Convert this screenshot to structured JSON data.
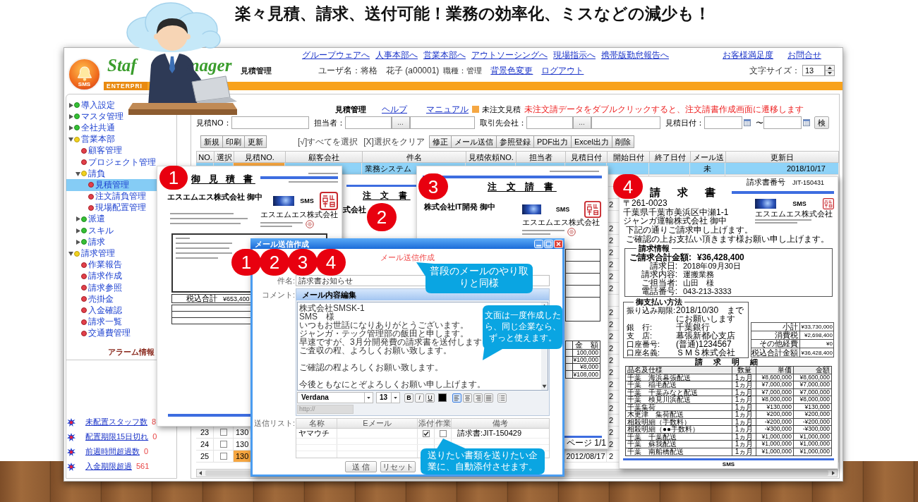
{
  "headline": "楽々見積、請求、送付可能！業務の効率化、ミスなどの減少も！",
  "header": {
    "emblem_text": "SMS",
    "brand_left": "Staf",
    "brand_right": "nager",
    "tagline": "ENTERPRI",
    "nav_links": [
      "グループウェアへ",
      "人事本部へ",
      "営業本部へ",
      "アウトソーシングへ",
      "現場指示へ",
      "携帯版勤怠報告へ"
    ],
    "support_links": [
      "お客様満足度",
      "お問合せ"
    ],
    "page_title": "見積管理",
    "user": "ユーザ名：将格　花子 (a00001)",
    "role": "職種：管理",
    "user_links": [
      "背景色変更",
      "ログアウト"
    ],
    "font_size_label": "文字サイズ：",
    "font_size": "13"
  },
  "sidebar": {
    "tree": [
      {
        "label": "導入設定",
        "kind": "group",
        "expanded": false,
        "selected": false
      },
      {
        "label": "マスタ管理",
        "kind": "group",
        "expanded": false,
        "selected": false
      },
      {
        "label": "全社共通",
        "kind": "group",
        "expanded": false,
        "selected": false
      },
      {
        "label": "営業本部",
        "kind": "group",
        "expanded": true,
        "selected": false,
        "children": [
          {
            "label": "顧客管理",
            "kind": "page",
            "selected": false
          },
          {
            "label": "プロジェクト管理",
            "kind": "page",
            "selected": false
          },
          {
            "label": "請負",
            "kind": "group",
            "expanded": true,
            "selected": false,
            "children": [
              {
                "label": "見積管理",
                "kind": "page",
                "selected": true
              },
              {
                "label": "注文請負管理",
                "kind": "page",
                "selected": false
              },
              {
                "label": "現場配置管理",
                "kind": "page",
                "selected": false
              }
            ]
          },
          {
            "label": "派遣",
            "kind": "group",
            "expanded": false,
            "selected": false
          },
          {
            "label": "スキル",
            "kind": "group",
            "expanded": false,
            "selected": false
          },
          {
            "label": "請求",
            "kind": "group",
            "expanded": false,
            "selected": false
          }
        ]
      },
      {
        "label": "請求管理",
        "kind": "group",
        "expanded": true,
        "selected": false,
        "children": [
          {
            "label": "作業報告",
            "kind": "page",
            "selected": false
          },
          {
            "label": "請求作成",
            "kind": "page",
            "selected": false
          },
          {
            "label": "請求参照",
            "kind": "page",
            "selected": false
          },
          {
            "label": "売掛金",
            "kind": "page",
            "selected": false
          },
          {
            "label": "入金確認",
            "kind": "page",
            "selected": false
          },
          {
            "label": "請求一覧",
            "kind": "page",
            "selected": false
          },
          {
            "label": "交通費管理",
            "kind": "page",
            "selected": false
          }
        ]
      }
    ],
    "alarm_title": "アラーム情報",
    "alarms": [
      {
        "label": "未配置スタッフ数",
        "count": "8"
      },
      {
        "label": "配置期限15日切れ",
        "count": "0"
      },
      {
        "label": "前週時間超過数",
        "count": "0"
      },
      {
        "label": "入金期限超過",
        "count": "561"
      }
    ]
  },
  "main": {
    "title": "見積管理",
    "links": [
      "ヘルプ",
      "マニュアル"
    ],
    "legend": "未注文見積",
    "notice": "未注文請データをダブルクリックすると、注文請書作成画面に遷移します",
    "search": [
      {
        "kind": "label",
        "text": "見積NO："
      },
      {
        "kind": "field"
      },
      {
        "kind": "label",
        "text": "担当者："
      },
      {
        "kind": "field"
      },
      {
        "kind": "picker",
        "text": "..."
      },
      {
        "kind": "field"
      },
      {
        "kind": "label",
        "text": "取引先会社："
      },
      {
        "kind": "field"
      },
      {
        "kind": "picker",
        "text": "..."
      },
      {
        "kind": "field"
      },
      {
        "kind": "label",
        "text": "見積日付："
      },
      {
        "kind": "field"
      },
      {
        "kind": "calendar"
      },
      {
        "kind": "label",
        "text": "〜"
      },
      {
        "kind": "field"
      },
      {
        "kind": "calendar"
      },
      {
        "kind": "button",
        "text": "検"
      }
    ],
    "toolbar": [
      {
        "kind": "buttons",
        "buttons": [
          "新規",
          "印刷",
          "更新"
        ]
      },
      {
        "kind": "link",
        "text": "[√]すべてを選択"
      },
      {
        "kind": "link",
        "text": "[X]選択をクリア"
      },
      {
        "kind": "buttons",
        "buttons": [
          "修正",
          "メール送信",
          "参照登録",
          "PDF出力",
          "Excel出力",
          "削除"
        ]
      }
    ],
    "columns": [
      "NO.",
      "選択",
      "見積NO.",
      "顧客会社",
      "件名",
      "見積依頼NO.",
      "担当者",
      "見積日付",
      "開始日付",
      "終了日付",
      "メール送",
      "更新日"
    ],
    "rows": [
      {
        "selected": true,
        "unordered": true,
        "subject": "業務システム",
        "mail_sent": "未",
        "updated": "2018/10/17"
      },
      {},
      {},
      {
        "start_date": "2"
      },
      {},
      {
        "start_date": "2"
      },
      {
        "start_date": "2"
      },
      {
        "start_date": "2"
      },
      {
        "start_date": "2"
      },
      {
        "start_date": "2"
      },
      {
        "start_date": "2"
      },
      {},
      {
        "start_date": "2"
      },
      {
        "start_date": "2"
      },
      {
        "start_date": "2"
      },
      {
        "start_date": "2"
      },
      {
        "start_date": "2"
      },
      {
        "start_date": "2"
      },
      {
        "start_date": "2"
      },
      {
        "start_date": "2"
      },
      {
        "start_date": "2"
      },
      {
        "start_date": "2"
      },
      {
        "selected": false,
        "no": "23",
        "checked": false,
        "unordered": false,
        "estimate_no": "130",
        "start_date": "2"
      },
      {
        "selected": false,
        "no": "24",
        "checked": false,
        "unordered": false,
        "estimate_no": "130",
        "start_date": "2"
      },
      {
        "selected": false,
        "no": "25",
        "checked": false,
        "unordered": true,
        "estimate_no": "130",
        "estimate_date": "2012/08/17",
        "start_date": "2"
      }
    ]
  },
  "documents": [
    {
      "kind": "estimate",
      "badge": "1",
      "title": "御 見 積 書",
      "addressee": "エスエムエス株式会社 御中",
      "logo_text": "SMS",
      "issuer": "エスエムエス株式会社",
      "total_label": "税込合計",
      "total": "¥653,400"
    },
    {
      "kind": "order",
      "badge": "2",
      "title": "注 文 書",
      "addressee": "式会社"
    },
    {
      "kind": "order_confirmation",
      "badge": "3",
      "title": "注 文 請 書",
      "addressee": "株式会社IT開発 御中",
      "logo_text": "SMS",
      "issuer": "エスエムエス株式会社",
      "amount_header": "金　額",
      "amounts": [
        "100,000",
        "¥100,000",
        "¥8,000",
        "¥108,000"
      ],
      "page": "ページ 1/1"
    },
    {
      "kind": "invoice",
      "badge": "4",
      "number_label": "請求書番号",
      "number": "JIT-150431",
      "title": "請 求 書",
      "recipient_lines": [
        "〒261-0023",
        "千葉県千葉市美浜区中瀬1-1",
        "ジャンガ運輸株式会社 御中"
      ],
      "logo_text": "SMS",
      "issuer": "エスエムエス株式会社",
      "message_lines": [
        "下記の通りご請求申し上げます。",
        "ご確認の上お支払い頂きます様お願い申し上げます。"
      ],
      "info_title": "請求情報",
      "total_label": "ご請求合計金額:",
      "total": "¥36,428,400",
      "info_rows": [
        {
          "label": "請求日:",
          "value": "2018年09月30日"
        },
        {
          "label": "請求内容:",
          "value": "運搬業務"
        },
        {
          "label": "ご担当者:",
          "value": "山田　様"
        },
        {
          "label": "電話番号:",
          "value": "043-213-3333"
        }
      ],
      "payment_title": "御支払い方法",
      "payment_rows": [
        {
          "label": "振り込み期限:",
          "value": "2018/10/30　までにお願いします"
        },
        {
          "label": "銀　行:",
          "value": "千葉銀行"
        },
        {
          "label": "支　店:",
          "value": "幕張新都心支店"
        },
        {
          "label": "口座番号:",
          "value": "(普通)1234567"
        },
        {
          "label": "口座名義:",
          "value": "ＳＭＳ株式会社"
        }
      ],
      "summary_rows": [
        {
          "label": "小計",
          "value": "¥33,730,000"
        },
        {
          "label": "消費税",
          "value": "¥2,698,400"
        },
        {
          "label": "その他経費",
          "value": "¥0"
        },
        {
          "label": "税込合計金額",
          "value": "¥36,428,400"
        }
      ],
      "detail_title": "請 求 明 細",
      "detail_columns": [
        "品名及仕様",
        "数量",
        "単価",
        "金額"
      ],
      "detail_rows": [
        [
          "千葉　海浜幕張配送",
          "1ヵ月",
          "¥8,600,000",
          "¥8,600,000"
        ],
        [
          "千葉　稲毛配送",
          "1ヵ月",
          "¥7,000,000",
          "¥7,000,000"
        ],
        [
          "千葉　千葉みなと配送",
          "1ヵ月",
          "¥7,000,000",
          "¥7,000,000"
        ],
        [
          "千葉　検見川浜配送",
          "1ヵ月",
          "¥8,000,000",
          "¥8,000,000"
        ],
        [
          "千葉集荷",
          "1ヵ月",
          "¥130,000",
          "¥130,000"
        ],
        [
          "木更津　集荷配送",
          "1ヵ月",
          "¥200,000",
          "¥200,000"
        ],
        [
          "相殺明細（手数料）",
          "1ヵ月",
          "-¥200,000",
          "-¥200,000"
        ],
        [
          "相殺明細（●●手数料）",
          "1ヵ月",
          "-¥300,000",
          "-¥300,000"
        ],
        [
          "千葉　千葉配送",
          "1ヵ月",
          "¥1,000,000",
          "¥1,000,000"
        ],
        [
          "千葉　蘇我配送",
          "1ヵ月",
          "¥1,000,000",
          "¥1,000,000"
        ],
        [
          "千葉　南船橋配送",
          "1ヵ月",
          "¥1,000,000",
          "¥1,000,000"
        ]
      ],
      "footer": "SMS"
    }
  ],
  "mail_dialog": {
    "title": "メール送信作成",
    "badges": [
      "1",
      "2",
      "3",
      "4"
    ],
    "heading": "メール送信作成",
    "subject_label": "件名:",
    "subject": "請求書お知らせ",
    "comment_label": "コメント:",
    "editor_title": "メール内容編集",
    "body_paragraphs": [
      [
        "株式会社SMSK-1",
        "SMS　様",
        "いつもお世話になりありがとうございます。",
        "ジャンガ・テック管理部の飯田と申します。",
        "早速ですが、3月分開発費の請求書を送付します",
        "ご査収の程、よろしくお願い致します。"
      ],
      [
        "ご確認の程よろしくお願い致します。"
      ],
      [
        "今後ともなにとぞよろしくお願い申し上げます。"
      ]
    ],
    "font": "Verdana",
    "font_size": "13",
    "format_buttons": [
      "B",
      "I",
      "U"
    ],
    "paragraph_buttons": [
      {
        "kind": "align_left",
        "selected": true
      },
      {
        "kind": "align_center",
        "selected": false
      },
      {
        "kind": "align_right",
        "selected": false
      },
      {
        "kind": "justify",
        "selected": false
      },
      {
        "kind": "list",
        "selected": false
      }
    ],
    "link_placeholder": "http://",
    "list_label": "送信リスト:",
    "list_columns": [
      "名称",
      "Eメール",
      "添付",
      "作業",
      "備考"
    ],
    "recipients": [
      {
        "name": "ヤマウチ",
        "attach": true,
        "work": false,
        "note": "請求書:JIT-150429"
      }
    ],
    "buttons": [
      "送 信",
      "リセット"
    ]
  },
  "callouts": [
    {
      "text": "普段のメールのやり取りと同様"
    },
    {
      "text": "文面は一度作成したら、同じ企業なら、ずっと使えます。"
    },
    {
      "text": "送りたい書類を送りたい企業に、自動添付させます。"
    }
  ]
}
